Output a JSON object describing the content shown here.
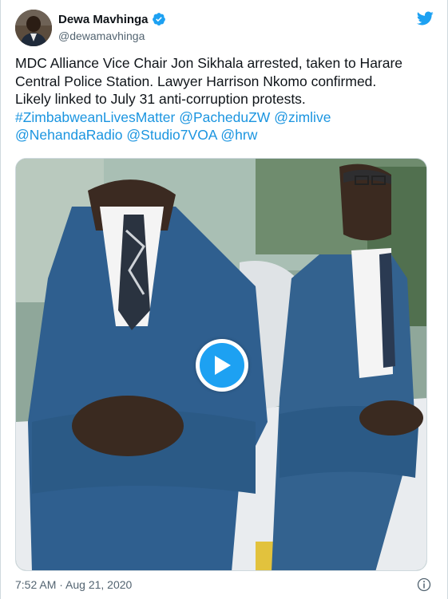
{
  "tweet": {
    "display_name": "Dewa Mavhinga",
    "handle": "@dewamavhinga",
    "verified_icon": "verified-badge-icon",
    "brand_icon": "twitter-bird-icon",
    "text_lines": [
      "MDC Alliance Vice Chair Jon Sikhala arrested, taken to Harare",
      "Central Police Station. Lawyer Harrison Nkomo confirmed.",
      "Likely linked to July 31 anti-corruption protests."
    ],
    "links": {
      "hashtag": "#ZimbabweanLivesMatter",
      "mention1": "@PacheduZW",
      "mention2": "@ziml​ive",
      "mention3": "@NehandaRadio",
      "mention4": "@Studio7VOA",
      "mention5": "@hrw"
    },
    "media": {
      "type": "video",
      "play_icon": "play-icon"
    },
    "timestamp": "7:52 AM · Aug 21, 2020",
    "info_icon": "info-icon"
  },
  "colors": {
    "link": "#1b95e0",
    "twitter_blue": "#1da1f2",
    "text": "#0f1419",
    "muted": "#536471"
  }
}
